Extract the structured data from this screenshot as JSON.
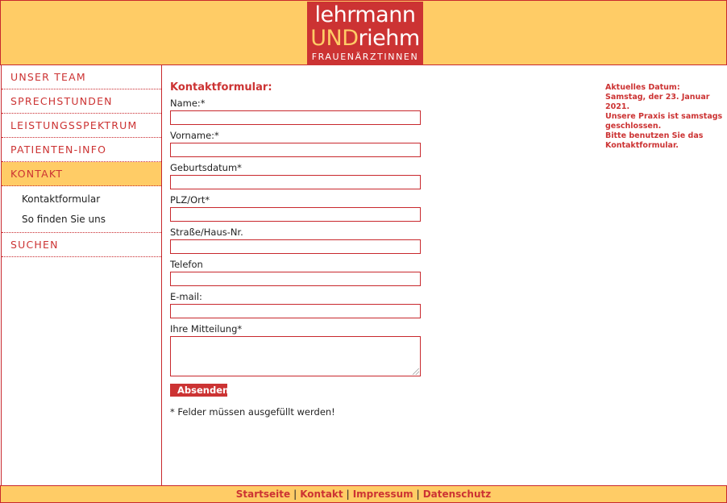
{
  "logo": {
    "line1": "lehrmann",
    "line2_und": "UND",
    "line2_rest": "riehm",
    "line3": "FRAUENÄRZTINNEN"
  },
  "nav": {
    "items": [
      {
        "label": "UNSER TEAM"
      },
      {
        "label": "SPRECHSTUNDEN"
      },
      {
        "label": "LEISTUNGSSPEKTRUM"
      },
      {
        "label": "PATIENTEN-INFO"
      },
      {
        "label": "KONTAKT",
        "active": true
      },
      {
        "label": "SUCHEN"
      }
    ],
    "sub_items": [
      {
        "label": "Kontaktformular"
      },
      {
        "label": "So finden Sie uns"
      }
    ]
  },
  "form": {
    "title": "Kontaktformular:",
    "fields": [
      {
        "label": "Name:*",
        "value": ""
      },
      {
        "label": "Vorname:*",
        "value": ""
      },
      {
        "label": "Geburtsdatum*",
        "value": ""
      },
      {
        "label": "PLZ/Ort*",
        "value": ""
      },
      {
        "label": "Straße/Haus-Nr.",
        "value": ""
      },
      {
        "label": "Telefon",
        "value": ""
      },
      {
        "label": "E-mail:",
        "value": ""
      }
    ],
    "message_label": "Ihre Mitteilung*",
    "submit_label": "Absenden",
    "required_note": "* Felder müssen ausgefüllt werden!"
  },
  "info": {
    "line1": "Aktuelles Datum:",
    "line2": "Samstag, der 23. Januar 2021.",
    "line3": "Unsere Praxis ist samstags geschlossen.",
    "line4": "Bitte benutzen Sie das Kontaktformular."
  },
  "footer": {
    "links": [
      "Startseite",
      "Kontakt",
      "Impressum",
      "Datenschutz"
    ],
    "separator": "|"
  },
  "colors": {
    "accent_red": "#cc3333",
    "header_yellow": "#ffcc66"
  }
}
